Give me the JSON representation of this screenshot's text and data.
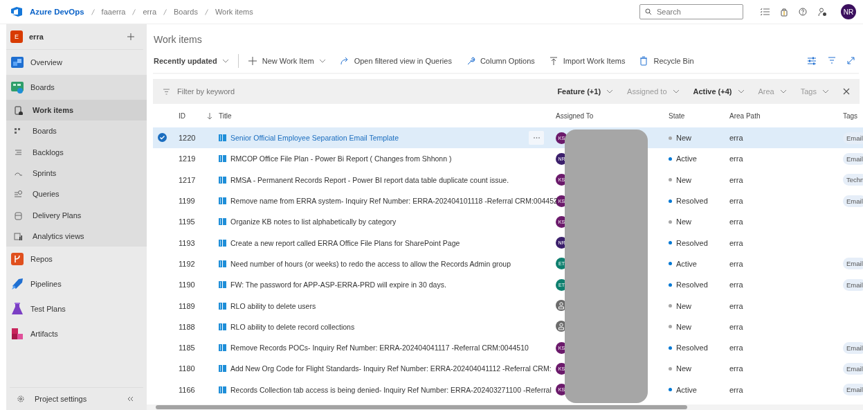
{
  "header": {
    "product": "Azure DevOps",
    "breadcrumbs": [
      "faaerra",
      "erra",
      "Boards",
      "Work items"
    ],
    "search": {
      "placeholder": "Search"
    },
    "avatar": "NR"
  },
  "sidebar": {
    "project": {
      "initial": "E",
      "name": "erra"
    },
    "items": [
      {
        "label": "Overview",
        "expanded": false
      },
      {
        "label": "Boards",
        "expanded": true,
        "children": [
          {
            "label": "Work items",
            "selected": true
          },
          {
            "label": "Boards",
            "selected": false
          },
          {
            "label": "Backlogs",
            "selected": false
          },
          {
            "label": "Sprints",
            "selected": false
          },
          {
            "label": "Queries",
            "selected": false
          },
          {
            "label": "Delivery Plans",
            "selected": false
          },
          {
            "label": "Analytics views",
            "selected": false
          }
        ]
      },
      {
        "label": "Repos",
        "expanded": false
      },
      {
        "label": "Pipelines",
        "expanded": false
      },
      {
        "label": "Test Plans",
        "expanded": false
      },
      {
        "label": "Artifacts",
        "expanded": false
      }
    ],
    "footer": "Project settings"
  },
  "page_title": "Work items",
  "toolbar": {
    "view": "Recently updated",
    "actions": [
      "New Work Item",
      "Open filtered view in Queries",
      "Column Options",
      "Import Work Items",
      "Recycle Bin"
    ]
  },
  "filter_bar": {
    "placeholder": "Filter by keyword",
    "filters": [
      {
        "label": "Feature (+1)",
        "active": true
      },
      {
        "label": "Assigned to",
        "active": false
      },
      {
        "label": "Active (+4)",
        "active": true
      },
      {
        "label": "Area",
        "active": false
      },
      {
        "label": "Tags",
        "active": false
      }
    ]
  },
  "table": {
    "columns": [
      "ID",
      "Title",
      "Assigned To",
      "State",
      "Area Path",
      "Tags"
    ],
    "rows": [
      {
        "id": "1220",
        "title": "Senior Official Employee Separation Email Template",
        "selected": true,
        "assignee": {
          "kind": "initials",
          "initials": "KS",
          "color": "#6b1a6b"
        },
        "state": {
          "label": "New",
          "color": "#a6a6a6"
        },
        "area": "erra",
        "tags": [
          "Email"
        ]
      },
      {
        "id": "1219",
        "title": "RMCOP Office File Plan - Power Bi Report ( Changes from Shhonn )",
        "selected": false,
        "assignee": {
          "kind": "initials",
          "initials": "NR",
          "color": "#3b1f6b"
        },
        "state": {
          "label": "Active",
          "color": "#0078d4"
        },
        "area": "erra",
        "tags": [
          "Email"
        ]
      },
      {
        "id": "1217",
        "title": "RMSA - Permanent Records Report - Power BI report data table duplicate count issue.",
        "selected": false,
        "assignee": {
          "kind": "initials",
          "initials": "KS",
          "color": "#6b1a6b"
        },
        "state": {
          "label": "New",
          "color": "#a6a6a6"
        },
        "area": "erra",
        "tags": [
          "Techn"
        ]
      },
      {
        "id": "1199",
        "title": "Remove name from ERRA system- Inquiry Ref Number: ERRA-202404101118 -Referral CRM:004452",
        "selected": false,
        "assignee": {
          "kind": "initials",
          "initials": "KS",
          "color": "#6b1a6b"
        },
        "state": {
          "label": "Resolved",
          "color": "#0078d4"
        },
        "area": "erra",
        "tags": [
          "Email"
        ]
      },
      {
        "id": "1195",
        "title": "Organize KB notes to list alphabetically by category",
        "selected": false,
        "assignee": {
          "kind": "initials",
          "initials": "KS",
          "color": "#6b1a6b"
        },
        "state": {
          "label": "New",
          "color": "#a6a6a6"
        },
        "area": "erra",
        "tags": []
      },
      {
        "id": "1193",
        "title": "Create a new report called ERRA Office File Plans for SharePoint Page",
        "selected": false,
        "assignee": {
          "kind": "initials",
          "initials": "NR",
          "color": "#3b1f6b"
        },
        "state": {
          "label": "Resolved",
          "color": "#0078d4"
        },
        "area": "erra",
        "tags": []
      },
      {
        "id": "1192",
        "title": "Need number of hours (or weeks) to redo the access to allow the Records Admin group",
        "selected": false,
        "assignee": {
          "kind": "initials",
          "initials": "ET",
          "color": "#0e7f6e"
        },
        "state": {
          "label": "Active",
          "color": "#0078d4"
        },
        "area": "erra",
        "tags": [
          "Email"
        ]
      },
      {
        "id": "1190",
        "title": "FW: The password for APP-ASP-ERRA-PRD will expire in 30 days.",
        "selected": false,
        "assignee": {
          "kind": "initials",
          "initials": "ET",
          "color": "#0e7f6e"
        },
        "state": {
          "label": "Resolved",
          "color": "#0078d4"
        },
        "area": "erra",
        "tags": [
          "Email"
        ]
      },
      {
        "id": "1189",
        "title": "RLO ability to delete users",
        "selected": false,
        "assignee": {
          "kind": "unassigned"
        },
        "state": {
          "label": "New",
          "color": "#a6a6a6"
        },
        "area": "erra",
        "tags": []
      },
      {
        "id": "1188",
        "title": "RLO ability to delete record collections",
        "selected": false,
        "assignee": {
          "kind": "unassigned"
        },
        "state": {
          "label": "New",
          "color": "#a6a6a6"
        },
        "area": "erra",
        "tags": []
      },
      {
        "id": "1185",
        "title": "Remove Records POCs- Inquiry Ref Number: ERRA-202404041117 -Referral CRM:0044510",
        "selected": false,
        "assignee": {
          "kind": "initials",
          "initials": "KS",
          "color": "#6b1a6b"
        },
        "state": {
          "label": "Resolved",
          "color": "#0078d4"
        },
        "area": "erra",
        "tags": [
          "Email"
        ]
      },
      {
        "id": "1180",
        "title": "Add New Org Code for Flight Standards- Inquiry Ref Number: ERRA-202404041112 -Referral CRM:",
        "selected": false,
        "assignee": {
          "kind": "initials",
          "initials": "KS",
          "color": "#6b1a6b"
        },
        "state": {
          "label": "New",
          "color": "#a6a6a6"
        },
        "area": "erra",
        "tags": [
          "Email"
        ]
      },
      {
        "id": "1166",
        "title": "Records Collection tab access is being denied- Inquiry Ref Number: ERRA-202403271100 -Referral",
        "selected": false,
        "assignee": {
          "kind": "initials",
          "initials": "KS",
          "color": "#6b1a6b"
        },
        "state": {
          "label": "Active",
          "color": "#0078d4"
        },
        "area": "erra",
        "tags": [
          "Email"
        ]
      }
    ]
  }
}
